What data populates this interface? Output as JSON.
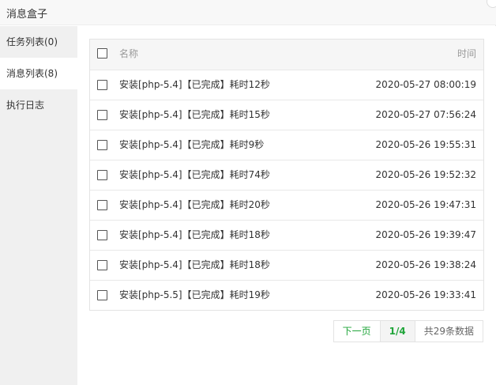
{
  "window": {
    "title": "消息盒子"
  },
  "sidebar": {
    "items": [
      {
        "label": "任务列表(0)"
      },
      {
        "label": "消息列表(8)"
      },
      {
        "label": "执行日志"
      }
    ],
    "active_index": 1
  },
  "table": {
    "headers": {
      "name": "名称",
      "time": "时间"
    },
    "rows": [
      {
        "name": "安装[php-5.4]【已完成】耗时12秒",
        "time": "2020-05-27 08:00:19"
      },
      {
        "name": "安装[php-5.4]【已完成】耗时15秒",
        "time": "2020-05-27 07:56:24"
      },
      {
        "name": "安装[php-5.4]【已完成】耗时9秒",
        "time": "2020-05-26 19:55:31"
      },
      {
        "name": "安装[php-5.4]【已完成】耗时74秒",
        "time": "2020-05-26 19:52:32"
      },
      {
        "name": "安装[php-5.4]【已完成】耗时20秒",
        "time": "2020-05-26 19:47:31"
      },
      {
        "name": "安装[php-5.4]【已完成】耗时18秒",
        "time": "2020-05-26 19:39:47"
      },
      {
        "name": "安装[php-5.4]【已完成】耗时18秒",
        "time": "2020-05-26 19:38:24"
      },
      {
        "name": "安装[php-5.5]【已完成】耗时19秒",
        "time": "2020-05-26 19:33:41"
      }
    ]
  },
  "pager": {
    "next_label": "下一页",
    "current": "1/4",
    "total": "共29条数据"
  },
  "colors": {
    "accent": "#20a53a"
  }
}
